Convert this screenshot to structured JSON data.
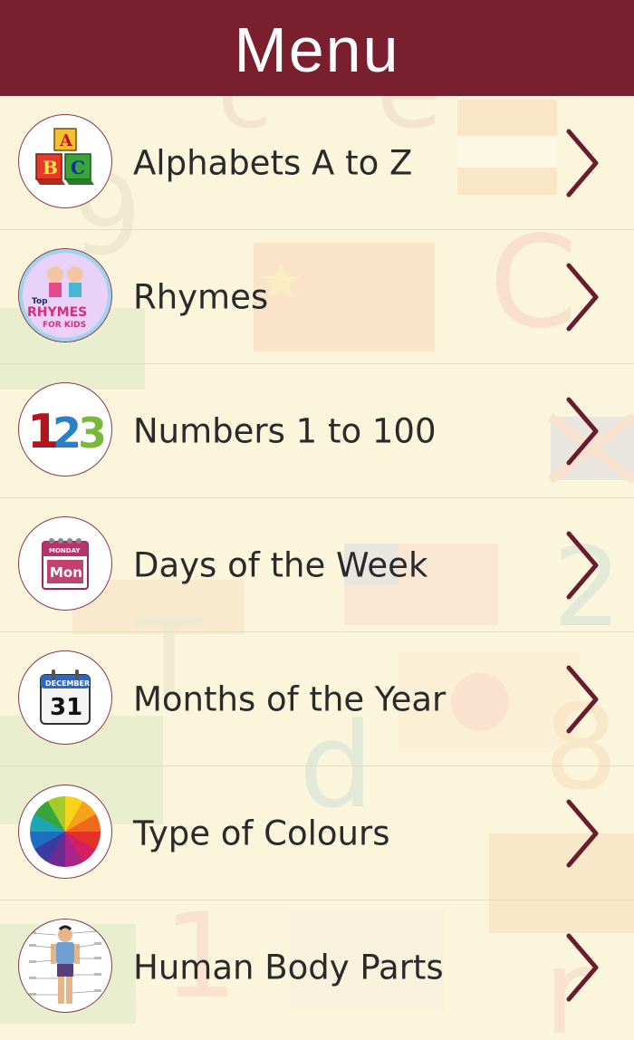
{
  "header": {
    "title": "Menu"
  },
  "menu": {
    "items": [
      {
        "label": "Alphabets A to Z",
        "icon": "abc-blocks-icon"
      },
      {
        "label": "Rhymes",
        "icon": "rhymes-kids-icon",
        "icon_text": "Top RHYMES FOR KIDS"
      },
      {
        "label": "Numbers 1 to 100",
        "icon": "numbers-123-icon"
      },
      {
        "label": "Days of the Week",
        "icon": "calendar-monday-icon",
        "icon_text": "MONDAY Mon"
      },
      {
        "label": "Months of the Year",
        "icon": "calendar-december-icon",
        "icon_text": "DECEMBER 31"
      },
      {
        "label": "Type of Colours",
        "icon": "colour-wheel-icon"
      },
      {
        "label": "Human Body Parts",
        "icon": "body-parts-chart-icon"
      }
    ]
  },
  "colors": {
    "header_bg": "#7a1f2e",
    "chevron": "#6a1c2c",
    "background": "#fbf5dc"
  }
}
